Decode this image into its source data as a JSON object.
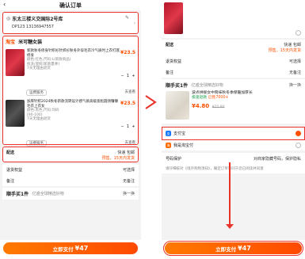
{
  "left": {
    "title": "确认订单",
    "address": {
      "name_line": "东太三楼义交国际2号库",
      "phone_line": "DP123 13136947557"
    },
    "shop": {
      "tag": "淘宝",
      "name": "米可糖女装"
    },
    "items": [
      {
        "title": "新款秋冬修身针织衫针织衫秋冬外穿毛衣冷气质时上衣打底修身",
        "spec": "颜色:红色;尺码:L(新款商品)",
        "spec2": "拆洗/混纺[新款夏季]",
        "spec3": "7天无理由退货",
        "price": "¥23.5",
        "qty": "1"
      },
      {
        "title": "加厚针织2024秋冬新款流转设计感气质高级宽松圆领慵懒毛衣上衣女",
        "spec": "颜色:黑色;尺码:均码",
        "spec2": "[90-100]",
        "spec3": "7天无理由退货",
        "price": "¥23.5",
        "qty": "1"
      }
    ],
    "service_label": "运费服务",
    "service_value": "去查看",
    "rows": [
      {
        "label": "配送",
        "value": "快递 包邮",
        "sub": "预售，15天内发货"
      },
      {
        "label": "退货权益",
        "value": "可选择"
      },
      {
        "label": "备注",
        "value": "无备注"
      }
    ],
    "bundle": {
      "title": "顺手买1件",
      "subtitle": "·亿盛全球精选好物",
      "swap": "换一换"
    },
    "pay_button": {
      "label": "立即支付",
      "amount": "¥47"
    }
  },
  "right": {
    "top_rows": [
      {
        "label": "配送",
        "value": "快递 包邮",
        "sub": "预售，15天内发货"
      },
      {
        "label": "退货权益",
        "value": "可选择"
      },
      {
        "label": "备注",
        "value": "无备注"
      }
    ],
    "bundle": {
      "title": "顺手买1件",
      "subtitle": "·亿盛全球精选好物",
      "swap": "换一换",
      "item_title": "波点拼接女中筒袜秋冬季保暖加厚长",
      "item_tag": "极速退款",
      "item_tag2": "已售7000+",
      "price": "¥4.80",
      "old_price": "¥25.80"
    },
    "payments": [
      {
        "name": "支付宝",
        "icon": "alipay-icon",
        "selected": true
      },
      {
        "name": "我是淘宝付",
        "icon": "taobao-pay-icon",
        "selected": false
      }
    ],
    "protection": {
      "label": "号码保护",
      "value": "对商家隐藏号码，保护隐私"
    },
    "notice": "请仔细核对《境外购物须知》，确定订单等同于您已阅读并同意",
    "pay_button": {
      "label": "立即支付",
      "amount": "¥47"
    }
  },
  "colors": {
    "accent": "#ff5000",
    "highlight": "#e8322a",
    "alipay": "#1677ff"
  }
}
